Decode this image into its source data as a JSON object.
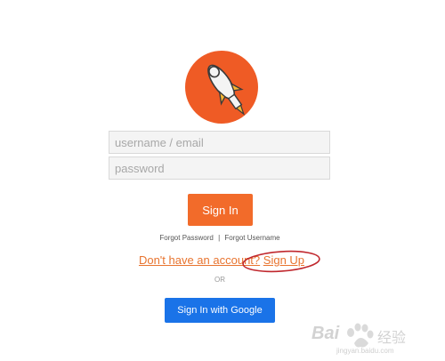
{
  "login": {
    "username_placeholder": "username / email",
    "password_placeholder": "password",
    "signin_label": "Sign In",
    "forgot_password": "Forgot Password",
    "separator": "|",
    "forgot_username": "Forgot Username",
    "no_account_text": "Don't have an account?",
    "signup_label": "Sign Up",
    "or_text": "OR",
    "google_label": "Sign In with Google"
  },
  "watermark": {
    "brand": "Bai",
    "brand_cn": "经验",
    "url": "jingyan.baidu.com"
  },
  "colors": {
    "brand_orange": "#f26b2a",
    "link_orange": "#e8742f",
    "google_blue": "#1a73e8",
    "annotation_red": "#c0272d"
  }
}
